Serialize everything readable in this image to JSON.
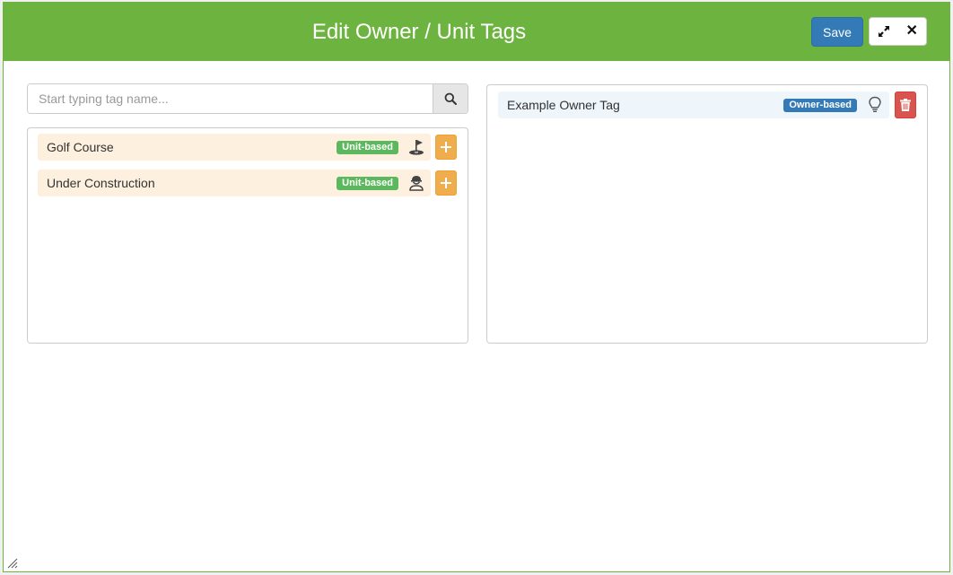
{
  "modal": {
    "title": "Edit Owner / Unit Tags",
    "save_label": "Save",
    "header_color": "#6db33f"
  },
  "search": {
    "placeholder": "Start typing tag name...",
    "value": ""
  },
  "available_tags": [
    {
      "name": "Golf Course",
      "badge": "Unit-based",
      "icon": "golf-flag-icon",
      "action": "add-icon"
    },
    {
      "name": "Under Construction",
      "badge": "Unit-based",
      "icon": "construction-worker-icon",
      "action": "add-icon"
    }
  ],
  "assigned_tags": [
    {
      "name": "Example Owner Tag",
      "badge": "Owner-based",
      "icon": "lightbulb-icon",
      "action": "trash-icon"
    }
  ],
  "colors": {
    "unit_badge": "#5cb85c",
    "owner_badge": "#337ab7",
    "add_button": "#f0ad4e",
    "delete_button": "#d9534f",
    "save_button": "#337ab7"
  }
}
